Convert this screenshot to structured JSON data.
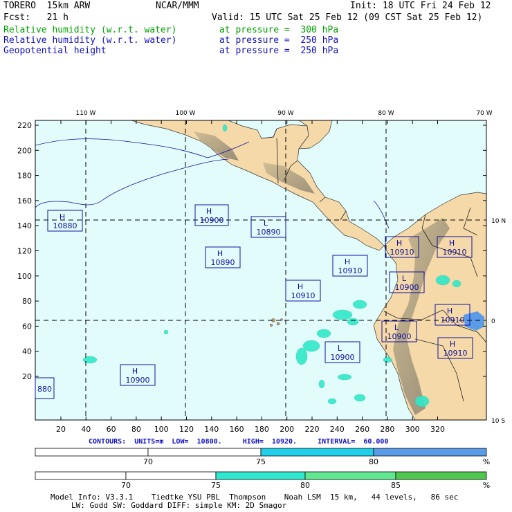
{
  "header": {
    "model": "TORERO  15km ARW",
    "org": "NCAR/MMM",
    "init": "Init: 18 UTC Fri 24 Feb 12",
    "fcst": "Fcst:   21 h",
    "valid": "Valid: 15 UTC Sat 25 Feb 12 (09 CST Sat 25 Feb 12)",
    "fields": [
      {
        "name": "Relative humidity (w.r.t. water)",
        "level": "at pressure =  300 hPa",
        "color": "#00a000"
      },
      {
        "name": "Relative humidity (w.r.t. water)",
        "level": "at pressure =  250 hPa",
        "color": "#1010c0"
      },
      {
        "name": "Geopotential height",
        "level": "at pressure =  250 hPa",
        "color": "#000000"
      }
    ]
  },
  "map": {
    "lon_labels": [
      "110 W",
      "100 W",
      "90 W",
      "80 W",
      "70 W"
    ],
    "lat_labels_right": [
      "10 N",
      "0",
      "10 S"
    ],
    "y_ticks": [
      "220",
      "200",
      "180",
      "160",
      "140",
      "120",
      "100",
      "80",
      "60",
      "40",
      "20"
    ],
    "x_ticks": [
      "20",
      "40",
      "60",
      "80",
      "100",
      "120",
      "140",
      "160",
      "180",
      "200",
      "220",
      "240",
      "260",
      "280",
      "300",
      "320"
    ],
    "centers": [
      {
        "type": "H",
        "value": "10880"
      },
      {
        "type": "H",
        "value": "10900"
      },
      {
        "type": "L",
        "value": "10890"
      },
      {
        "type": "H",
        "value": "10890"
      },
      {
        "type": "H",
        "value": "10910"
      },
      {
        "type": "H",
        "value": "10910"
      },
      {
        "type": "H",
        "value": "10910"
      },
      {
        "type": "L",
        "value": "10900"
      },
      {
        "type": "H",
        "value": "10910"
      },
      {
        "type": "L",
        "value": "10900"
      },
      {
        "type": "H",
        "value": "10910"
      },
      {
        "type": "L",
        "value": "10900"
      },
      {
        "type": "H",
        "value": "10900"
      },
      {
        "type": "H",
        "value": "10910"
      },
      {
        "type": "",
        "value": "880"
      }
    ]
  },
  "contours": "CONTOURS:  UNITS=m  LOW=  10800.     HIGH=  10920.     INTERVAL=  60.000",
  "colorbar_blue": {
    "labels": [
      "70",
      "75",
      "80"
    ],
    "unit": "%",
    "colors": [
      "#ffffff",
      "#ffffff",
      "#20d0e8",
      "#5a9ce8"
    ]
  },
  "colorbar_green": {
    "labels": [
      "70",
      "75",
      "80",
      "85"
    ],
    "unit": "%",
    "colors": [
      "#ffffff",
      "#ffffff",
      "#30e8d0",
      "#60e890",
      "#50c850"
    ]
  },
  "footer": {
    "line1": "Model Info: V3.3.1    Tiedtke YSU PBL  Thompson    Noah LSM  15 km,   44 levels,   86 sec",
    "line2": "LW: Godd SW: Goddard DIFF: simple KM: 2D Smagor"
  }
}
